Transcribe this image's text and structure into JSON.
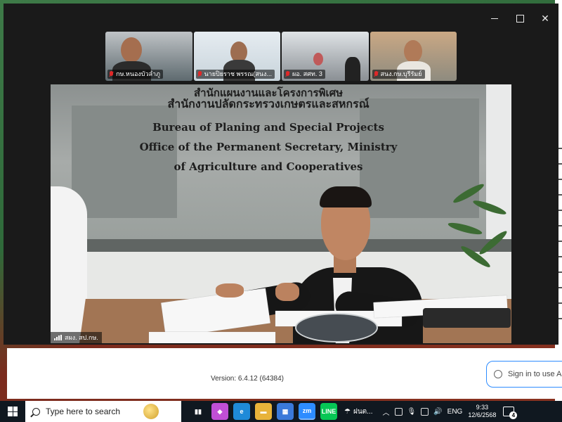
{
  "thumbnails": [
    {
      "label": "กษ.หนองบัวลำภู"
    },
    {
      "label": "นายปิยราช  พรรณ(สนง..."
    },
    {
      "label": "ผอ. สศท. 3"
    },
    {
      "label": "สนง.กษ.บุรีรัมย์"
    }
  ],
  "main_video": {
    "label": "สผง. สป.กษ.",
    "backdrop": {
      "line_top": "สำนักแผนงานและโครงการพิเศษ",
      "line_thai": "สำนักงานปลัดกระทรวงเกษตรและสหกรณ์",
      "line_en1": "Bureau of Planing and Special Projects",
      "line_en2": "Office of the Permanent Secretary, Ministry",
      "line_en3": "of Agriculture and Cooperatives"
    }
  },
  "launcher": {
    "version": "Version: 6.4.12 (64384)",
    "signin": "Sign in to use A"
  },
  "taskbar": {
    "search_placeholder": "Type here to search",
    "apps": [
      {
        "name": "task-view",
        "glyph": "▮▮",
        "color": "#101820"
      },
      {
        "name": "copilot",
        "glyph": "◆",
        "color": "#c04fd6"
      },
      {
        "name": "edge",
        "glyph": "e",
        "color": "#1f8ad8"
      },
      {
        "name": "file-explorer",
        "glyph": "▬",
        "color": "#e8b33a"
      },
      {
        "name": "store",
        "glyph": "▦",
        "color": "#3a79d9"
      },
      {
        "name": "zoom",
        "glyph": "zm",
        "color": "#2d8cff"
      },
      {
        "name": "line",
        "glyph": "LINE",
        "color": "#06c755"
      }
    ],
    "weather": "ฝนต...",
    "language": "ENG",
    "time": "9:33",
    "date": "12/6/2568",
    "notification_count": "4"
  }
}
